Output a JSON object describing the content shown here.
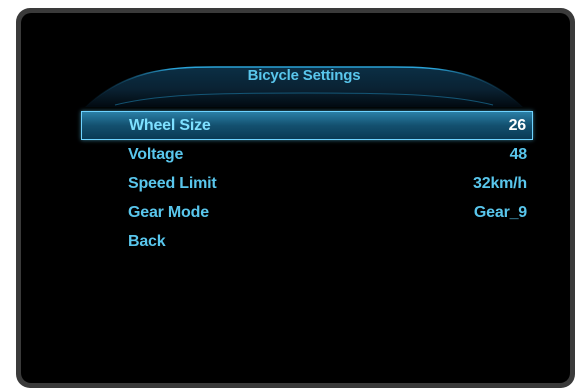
{
  "header": {
    "title": "Bicycle Settings"
  },
  "menu": {
    "items": [
      {
        "label": "Wheel Size",
        "value": "26",
        "selected": true
      },
      {
        "label": "Voltage",
        "value": "48",
        "selected": false
      },
      {
        "label": "Speed Limit",
        "value": "32km/h",
        "selected": false
      },
      {
        "label": "Gear Mode",
        "value": "Gear_9",
        "selected": false
      },
      {
        "label": "Back",
        "value": "",
        "selected": false
      }
    ]
  },
  "colors": {
    "accent": "#59c6ec",
    "selection_border": "#6fd3ff",
    "selected_value": "#ffffff",
    "background": "#000000",
    "bezel": "#3a3a3a"
  }
}
